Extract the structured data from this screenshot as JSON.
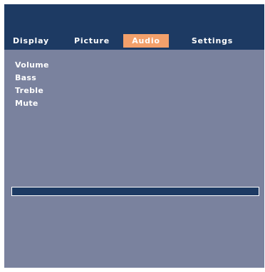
{
  "tabs": [
    {
      "label": "Display",
      "active": false
    },
    {
      "label": "Picture",
      "active": false
    },
    {
      "label": "Audio",
      "active": true
    },
    {
      "label": "Settings",
      "active": false
    }
  ],
  "menu": {
    "items": [
      "Volume",
      "Bass",
      "Treble",
      "Mute"
    ]
  },
  "colors": {
    "header": "#1d3a63",
    "panel": "#7a829e",
    "active_tab": "#f3a06b",
    "text": "#ffffff"
  }
}
